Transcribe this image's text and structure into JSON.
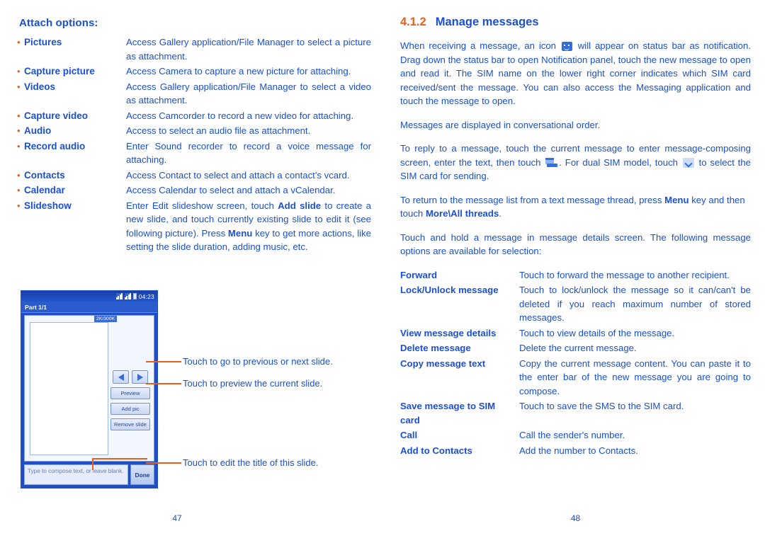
{
  "left_page": {
    "heading": "Attach options:",
    "attach_options": [
      {
        "term": "Pictures",
        "desc": "Access Gallery application/File Manager to select a picture as attachment."
      },
      {
        "term": "Capture picture",
        "desc": "Access Camera to capture a new picture for attaching."
      },
      {
        "term": "Videos",
        "desc": "Access Gallery application/File Manager to select a video as attachment."
      },
      {
        "term": "Capture video",
        "desc": "Access Camcorder to record a new video for attaching."
      },
      {
        "term": "Audio",
        "desc": "Access to select an audio file as attachment."
      },
      {
        "term": "Record audio",
        "desc": "Enter Sound recorder to record a voice message for attaching."
      },
      {
        "term": "Contacts",
        "desc": "Access Contact to select and attach a contact's vcard."
      },
      {
        "term": "Calendar",
        "desc": "Access Calendar to select and attach a vCalendar."
      },
      {
        "term": "Slideshow",
        "desc_parts": [
          "Enter Edit slideshow screen, touch ",
          "Add slide",
          " to create a new slide, and touch currently existing slide to edit it (see following picture). Press ",
          "Menu",
          " key to get more actions, like setting the slide duration, adding music, etc."
        ]
      }
    ],
    "phone_mock": {
      "status_clock": "04:23",
      "title_bar": "Part 1/1",
      "size_tag": "2K/300K",
      "buttons": {
        "prev": "previous-slide-arrow",
        "next": "next-slide-arrow",
        "preview": "Preview",
        "add_pic": "Add pic",
        "remove_slide": "Remove slide"
      },
      "compose_placeholder": "Type to compose text, or leave blank.",
      "done_label": "Done"
    },
    "callouts": [
      "Touch to go to previous or next slide.",
      "Touch to preview the current slide.",
      "Touch to edit the title of this slide."
    ],
    "page_number": "47"
  },
  "right_page": {
    "section_number": "4.1.2",
    "section_title": "Manage messages",
    "paragraph_1_a": "When receiving a message, an icon ",
    "paragraph_1_b": " will appear on status bar as notification. Drag down the status bar to open Notification panel, touch the new message to open and read it. The SIM name on the lower right corner indicates which SIM card received/sent the message. You can also access the Messaging application and touch the message to open.",
    "paragraph_2": "Messages are displayed in conversational order.",
    "paragraph_3_a": "To reply to a message, touch the current message to enter message-composing screen, enter the text, then touch ",
    "paragraph_3_b": ". For dual SIM model, touch ",
    "paragraph_3_c": " to select the SIM card for sending.",
    "paragraph_4_a": "To return to the message list from a text message thread, press ",
    "paragraph_4_b": "Menu",
    "paragraph_4_c": " key and then touch ",
    "paragraph_4_d": "More\\All threads",
    "paragraph_4_e": ".",
    "paragraph_5": "Touch and hold a message in message details screen. The following message options are available for selection:",
    "message_options": [
      {
        "term": "Forward",
        "desc": "Touch to forward the message to another recipient."
      },
      {
        "term": "Lock/Unlock message",
        "desc": "Touch to lock/unlock the message so it can/can't be deleted if you reach maximum number of stored messages."
      },
      {
        "term": "View message details",
        "desc": "Touch to view details of the message."
      },
      {
        "term": "Delete message",
        "desc": "Delete the current message."
      },
      {
        "term": "Copy message text",
        "desc": "Copy the current message content. You can paste it to the enter bar of the new message you are going to compose."
      },
      {
        "term": "Save message to SIM card",
        "desc": "Touch to save the SMS to the SIM card."
      },
      {
        "term": "Call",
        "desc": "Call the sender's number."
      },
      {
        "term": "Add to Contacts",
        "desc": "Add the number to Contacts."
      }
    ],
    "page_number": "48"
  },
  "colors": {
    "text_blue": "#1a4fd6",
    "accent_orange": "#E8601C",
    "phone_chrome": "#1f4fc4"
  },
  "icons": {
    "message_notification": "message-bubble-icon",
    "send_message": "send-message-icon",
    "sim_select": "chevron-down-icon"
  }
}
